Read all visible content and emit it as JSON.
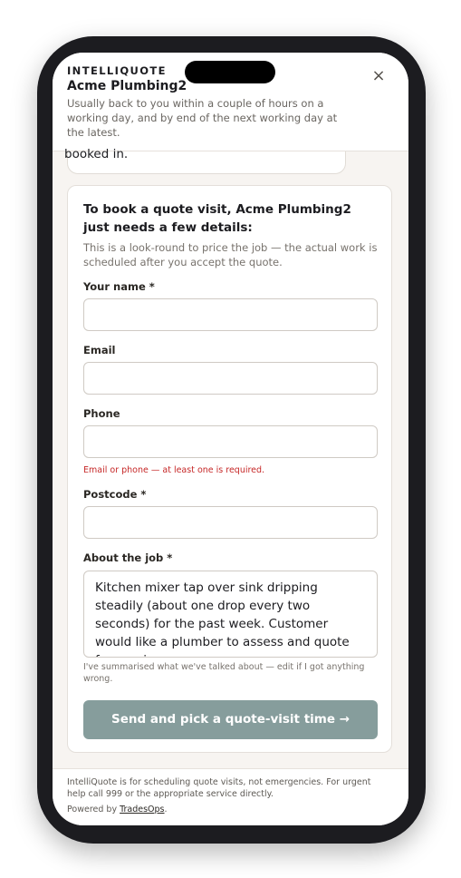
{
  "header": {
    "brand": "INTELLIQUOTE",
    "business_name": "Acme Plumbing2",
    "response_time": "Usually back to you within a couple of hours on a working day, and by end of the next working day at the latest.",
    "close_icon": "×"
  },
  "chat": {
    "last_message_fragment": "booked in."
  },
  "form": {
    "title": "To book a quote visit, Acme Plumbing2 just needs a few details:",
    "subtitle": "This is a look-round to price the job — the actual work is scheduled after you accept the quote.",
    "fields": {
      "name_label": "Your name *",
      "name_value": "",
      "email_label": "Email",
      "email_value": "",
      "phone_label": "Phone",
      "phone_value": "",
      "contact_error": "Email or phone — at least one is required.",
      "postcode_label": "Postcode *",
      "postcode_value": "",
      "job_label": "About the job *",
      "job_value": "Kitchen mixer tap over sink dripping steadily (about one drop every two seconds) for the past week. Customer would like a plumber to assess and quote for repair."
    },
    "summary_hint": "I've summarised what we've talked about — edit if I got anything wrong.",
    "submit_label": "Send and pick a quote-visit time →"
  },
  "footer": {
    "disclaimer": "IntelliQuote is for scheduling quote visits, not emergencies. For urgent help call 999 or the appropriate service directly.",
    "powered_prefix": "Powered by ",
    "powered_link": "TradesOps",
    "powered_suffix": "."
  },
  "colors": {
    "button_bg": "#869d9c",
    "error_text": "#c62828",
    "screen_bg": "#f7f4f1"
  }
}
